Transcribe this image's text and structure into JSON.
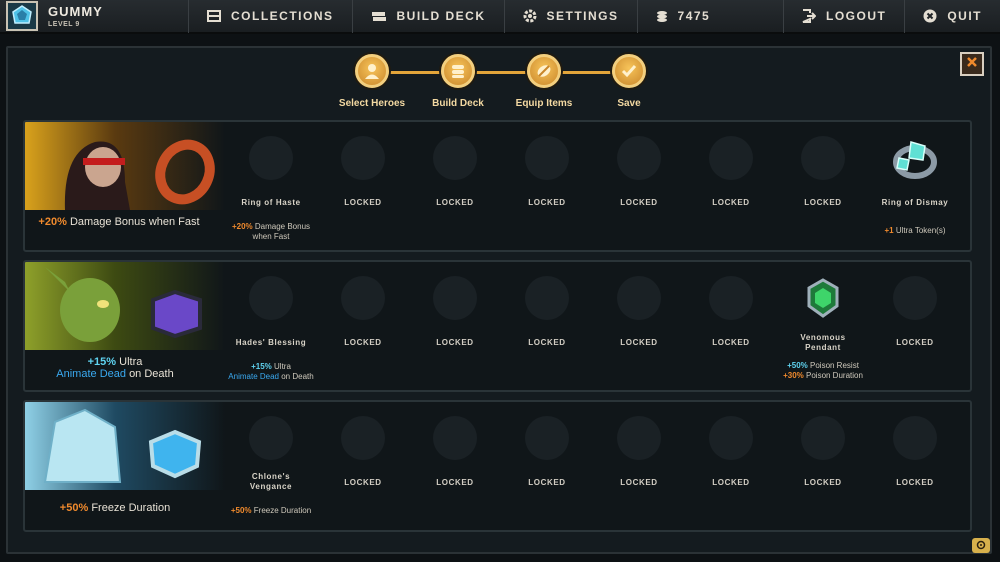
{
  "profile": {
    "name": "GUMMY",
    "level": "LEVEL 9"
  },
  "nav": {
    "collections": "COLLECTIONS",
    "build_deck": "BUILD DECK",
    "settings": "SETTINGS",
    "coins": "7475",
    "logout": "LOGOUT",
    "quit": "QUIT"
  },
  "steps": [
    "Select Heroes",
    "Build Deck",
    "Equip Items",
    "Save"
  ],
  "locked_label": "LOCKED",
  "heroes": [
    {
      "bonus_value": "+20%",
      "bonus_text": "Damage Bonus when Fast",
      "items": [
        {
          "name": "Ring of Haste",
          "stat_value": "+20%",
          "stat_text": "Damage Bonus when Fast"
        },
        {
          "name": "Ring of Dismay",
          "stat_value": "+1",
          "stat_text": "Ultra Token(s)"
        }
      ]
    },
    {
      "bonus_value": "+15%",
      "bonus_text_a": "Ultra",
      "bonus_link": "Animate Dead",
      "bonus_text_b": "on Death",
      "items": [
        {
          "name": "Hades' Blessing",
          "stat_value": "+15%",
          "stat_text_a": "Ultra",
          "stat_link": "Animate Dead",
          "stat_text_b": "on Death"
        },
        {
          "name_a": "Venomous",
          "name_b": "Pendant",
          "stat1_value": "+50%",
          "stat1_text": "Poison Resist",
          "stat2_value": "+30%",
          "stat2_text": "Poison Duration"
        }
      ]
    },
    {
      "bonus_value": "+50%",
      "bonus_text": "Freeze Duration",
      "items": [
        {
          "name_a": "Chlone's",
          "name_b": "Vengance",
          "stat_value": "+50%",
          "stat_text": "Freeze Duration"
        }
      ]
    }
  ],
  "colors": {
    "accent_gold": "#e3a53a",
    "stat_orange": "#f08a2d",
    "stat_cyan": "#5fd3f0",
    "link_blue": "#3aa9f0"
  },
  "icons": [
    "crystal-emblem-icon",
    "collections-icon",
    "deck-icon",
    "gear-icon",
    "coins-icon",
    "logout-icon",
    "quit-icon",
    "close-icon",
    "hero-icon",
    "equip-icon",
    "check-icon",
    "chat-icon"
  ]
}
